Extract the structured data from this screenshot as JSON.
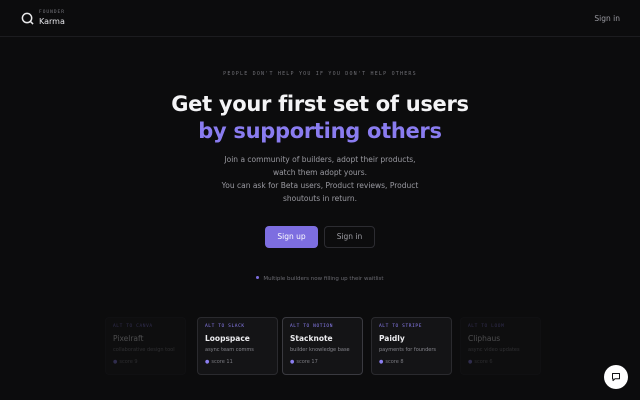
{
  "header": {
    "brand_kicker": "FOUNDER",
    "brand_name": "Karma",
    "signin_label": "Sign in",
    "logo_icon": "circle-logo-icon"
  },
  "hero": {
    "kicker": "PEOPLE DON'T HELP YOU IF YOU DON'T HELP OTHERS",
    "headline_line1": "Get your first set of users",
    "headline_line2": "by supporting others",
    "description_lines": [
      "Join a community of builders, adopt their products,",
      "watch them adopt yours.",
      "You can ask for Beta users, Product reviews, Product",
      "shoutouts in return."
    ],
    "primary_button": "Sign up",
    "secondary_button": "Sign in",
    "status_text": "Multiple builders now filling up their waitlist"
  },
  "cards": [
    {
      "alt": "ALT TO CANVA",
      "name": "Pixelraft",
      "tagline": "collaborative design tool",
      "score": "score 9"
    },
    {
      "alt": "ALT TO SLACK",
      "name": "Loopspace",
      "tagline": "async team comms",
      "score": "score 11"
    },
    {
      "alt": "ALT TO NOTION",
      "name": "Stacknote",
      "tagline": "builder knowledge base",
      "score": "score 17"
    },
    {
      "alt": "ALT TO STRIPE",
      "name": "Paidly",
      "tagline": "payments for founders",
      "score": "score 8"
    },
    {
      "alt": "ALT TO LOOM",
      "name": "Cliphaus",
      "tagline": "async video updates",
      "score": "score 6"
    }
  ],
  "colors": {
    "accent": "#7d6ee0",
    "headline_accent": "#8a7cf0",
    "background": "#0c0c0d"
  },
  "chat": {
    "icon": "chat-bubble-icon"
  }
}
